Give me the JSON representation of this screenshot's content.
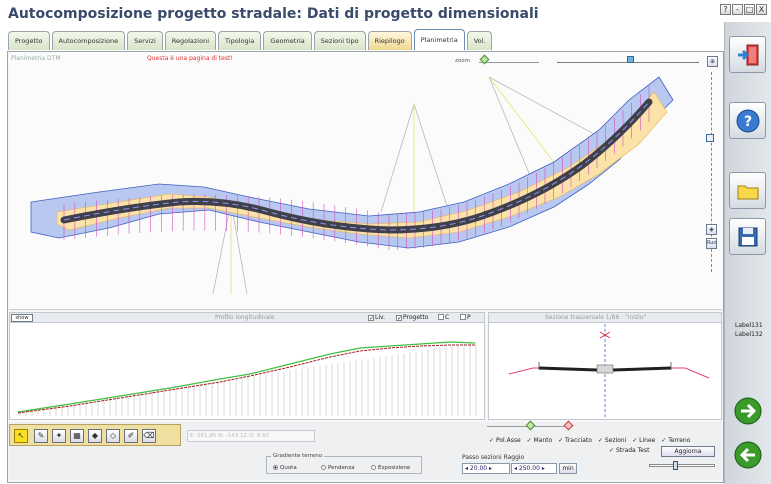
{
  "window": {
    "title": "Autocomposizione progetto stradale: Dati di progetto dimensionali",
    "controls": [
      "?",
      "-",
      "□",
      "X"
    ]
  },
  "tabs": [
    {
      "label": "Progetto",
      "active": false
    },
    {
      "label": "Autocomposizione",
      "active": false
    },
    {
      "label": "Servizi",
      "active": false
    },
    {
      "label": "Regolazioni",
      "active": false
    },
    {
      "label": "Tipologia",
      "active": false
    },
    {
      "label": "Geometria",
      "active": false
    },
    {
      "label": "Sezioni tipo",
      "active": false
    },
    {
      "label": "Riepilogo",
      "active": false
    },
    {
      "label": "Planimetria",
      "active": true
    },
    {
      "label": "Vol.",
      "active": false
    }
  ],
  "planimetria": {
    "label": "Planimetria DTM",
    "test_message": "Questa è una pagina di test!",
    "zoom_label": "zoom",
    "run_label": "Run"
  },
  "profilo": {
    "show_button": "show",
    "title": "Profilo longitudinale",
    "checks": [
      {
        "label": "Liv.",
        "checked": true
      },
      {
        "label": "Progetto",
        "checked": true
      },
      {
        "label": "C",
        "checked": false
      },
      {
        "label": "P",
        "checked": false
      }
    ]
  },
  "sezione": {
    "title": "Sezione trasversale 1/86 : \"inizio\""
  },
  "bottom": {
    "coords_text": "E: 561.85  N: -143.12  Q: 8.60",
    "gradiente": {
      "title": "Gradiente terreno",
      "options": [
        {
          "label": "Quota",
          "selected": true
        },
        {
          "label": "Pendenza",
          "selected": false
        },
        {
          "label": "Esposizione",
          "selected": false
        }
      ]
    },
    "passo_label": "Passo sezioni",
    "raggio_label": "Raggio",
    "passo_value": "20.00",
    "raggio_value": "250.00",
    "min_button": "min",
    "layer_checks": [
      "Pol.Asse",
      "Manto",
      "Tracciato",
      "Sezioni",
      "Linee",
      "Terreno"
    ],
    "strada_test": "Strada Test",
    "aggiorna": "Aggiorna"
  },
  "sidebar": {
    "label131": "Label131",
    "label132": "Label132"
  },
  "colors": {
    "accent_green": "#3a9a2a",
    "tab_active_border": "#6a8ab0",
    "road": "#404048",
    "terrain_profile": "#40c040",
    "design_profile": "#a02020"
  }
}
